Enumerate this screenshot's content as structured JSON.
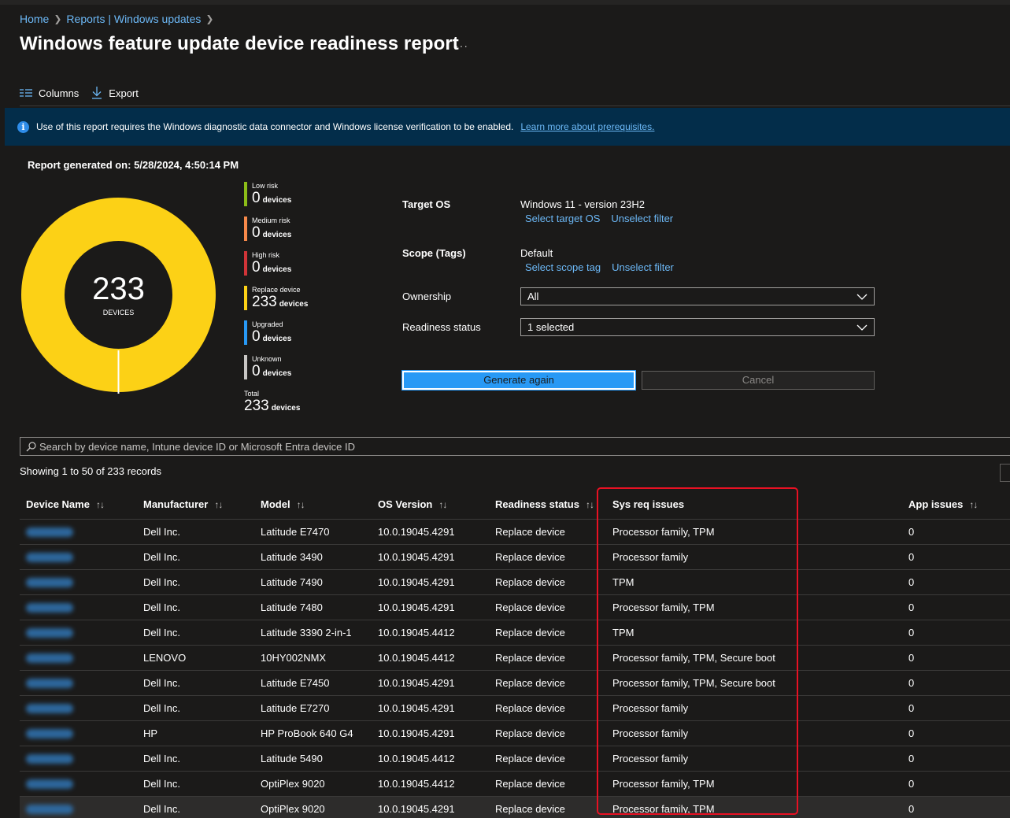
{
  "breadcrumb": {
    "home": "Home",
    "reports": "Reports | Windows updates"
  },
  "page": {
    "title": "Windows feature update device readiness report",
    "more": "···"
  },
  "toolbar": {
    "columns": "Columns",
    "export": "Export"
  },
  "info": {
    "icon": "info-icon",
    "text": "Use of this report requires the Windows diagnostic data connector and Windows license verification to be enabled.",
    "link": "Learn more about prerequisites."
  },
  "report": {
    "generated": "Report generated on: 5/28/2024, 4:50:14 PM"
  },
  "donut": {
    "total": "233",
    "label": "DEVICES",
    "color": "#fcd116",
    "separator_color": "#ffffff"
  },
  "legend": [
    {
      "label": "Low risk",
      "value": "0",
      "unit": "devices",
      "color": "#8cbd18"
    },
    {
      "label": "Medium risk",
      "value": "0",
      "unit": "devices",
      "color": "#f7894a"
    },
    {
      "label": "High risk",
      "value": "0",
      "unit": "devices",
      "color": "#d13438"
    },
    {
      "label": "Replace device",
      "value": "233",
      "unit": "devices",
      "color": "#fcd116"
    },
    {
      "label": "Upgraded",
      "value": "0",
      "unit": "devices",
      "color": "#2899f5"
    },
    {
      "label": "Unknown",
      "value": "0",
      "unit": "devices",
      "color": "#c8c6c4"
    },
    {
      "label": "Total",
      "value": "233",
      "unit": "devices",
      "color": ""
    }
  ],
  "filters": {
    "target_os": {
      "label": "Target OS",
      "value": "Windows 11 - version 23H2",
      "link1": "Select target OS",
      "link2": "Unselect filter"
    },
    "scope": {
      "label": "Scope (Tags)",
      "value": "Default",
      "link1": "Select scope tag",
      "link2": "Unselect filter"
    },
    "ownership": {
      "label": "Ownership",
      "value": "All"
    },
    "readiness": {
      "label": "Readiness status",
      "value": "1 selected"
    }
  },
  "actions": {
    "generate": "Generate again",
    "cancel": "Cancel"
  },
  "search": {
    "placeholder": "Search by device name, Intune device ID or Microsoft Entra device ID"
  },
  "records": {
    "showing": "Showing 1 to 50 of 233 records"
  },
  "table": {
    "headers": [
      "Device Name",
      "Manufacturer",
      "Model",
      "OS Version",
      "Readiness status",
      "Sys req issues",
      "App issues"
    ],
    "sort_glyph": "↑↓",
    "rows": [
      [
        "Dell Inc.",
        "Latitude E7470",
        "10.0.19045.4291",
        "Replace device",
        "Processor family, TPM",
        "0"
      ],
      [
        "Dell Inc.",
        "Latitude 3490",
        "10.0.19045.4291",
        "Replace device",
        "Processor family",
        "0"
      ],
      [
        "Dell Inc.",
        "Latitude 7490",
        "10.0.19045.4291",
        "Replace device",
        "TPM",
        "0"
      ],
      [
        "Dell Inc.",
        "Latitude 7480",
        "10.0.19045.4291",
        "Replace device",
        "Processor family, TPM",
        "0"
      ],
      [
        "Dell Inc.",
        "Latitude 3390 2-in-1",
        "10.0.19045.4412",
        "Replace device",
        "TPM",
        "0"
      ],
      [
        "LENOVO",
        "10HY002NMX",
        "10.0.19045.4412",
        "Replace device",
        "Processor family, TPM, Secure boot",
        "0"
      ],
      [
        "Dell Inc.",
        "Latitude E7450",
        "10.0.19045.4291",
        "Replace device",
        "Processor family, TPM, Secure boot",
        "0"
      ],
      [
        "Dell Inc.",
        "Latitude E7270",
        "10.0.19045.4291",
        "Replace device",
        "Processor family",
        "0"
      ],
      [
        "HP",
        "HP ProBook 640 G4",
        "10.0.19045.4291",
        "Replace device",
        "Processor family",
        "0"
      ],
      [
        "Dell Inc.",
        "Latitude 5490",
        "10.0.19045.4412",
        "Replace device",
        "Processor family",
        "0"
      ],
      [
        "Dell Inc.",
        "OptiPlex 9020",
        "10.0.19045.4412",
        "Replace device",
        "Processor family, TPM",
        "0"
      ],
      [
        "Dell Inc.",
        "OptiPlex 9020",
        "10.0.19045.4291",
        "Replace device",
        "Processor family, TPM",
        "0"
      ]
    ]
  }
}
